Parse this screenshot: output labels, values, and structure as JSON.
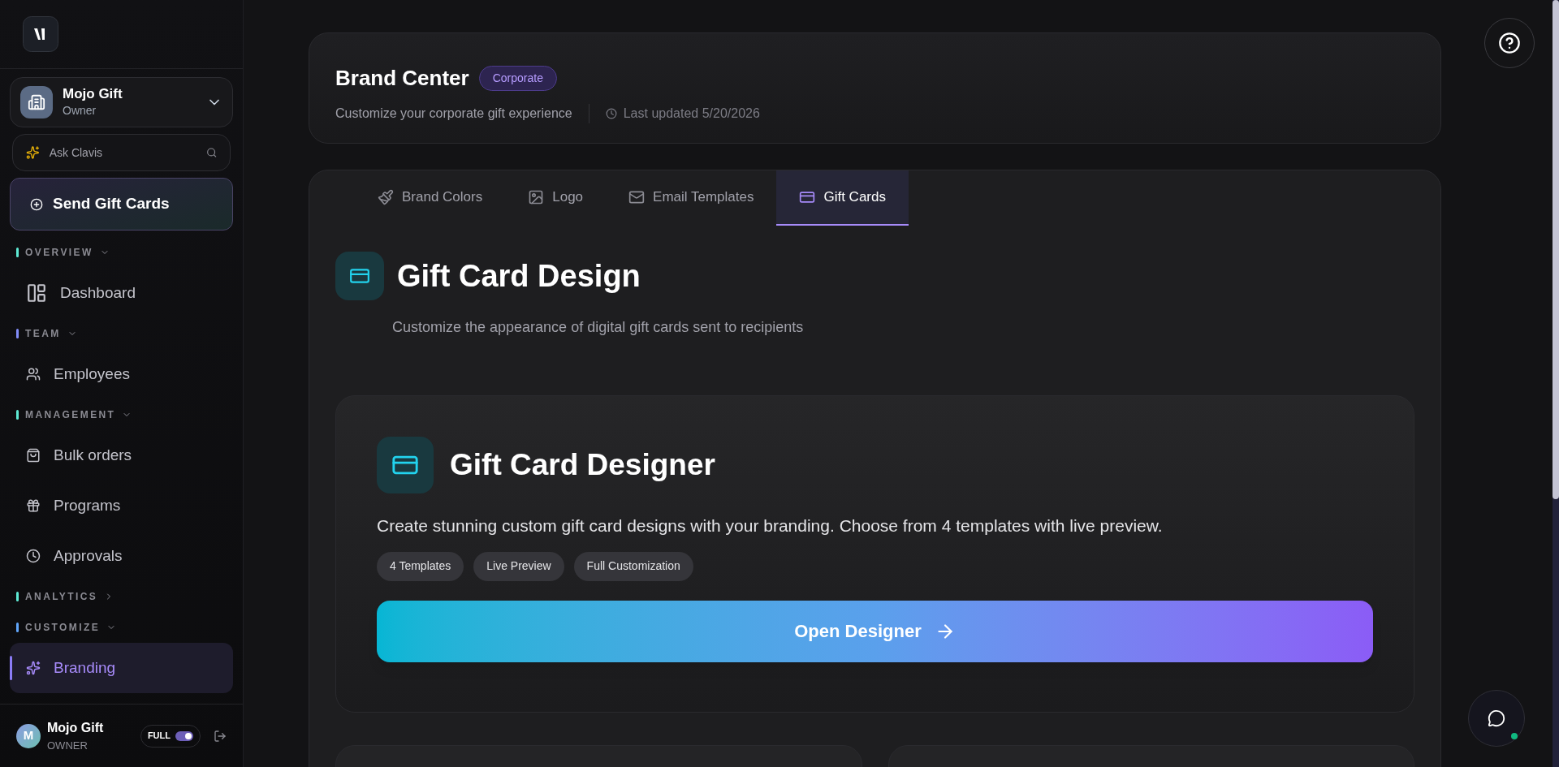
{
  "sidebar": {
    "account": {
      "name": "Mojo Gift",
      "role": "Owner"
    },
    "search": {
      "placeholder": "Ask Clavis"
    },
    "primary_button": "Send Gift Cards",
    "sections": [
      {
        "label": "OVERVIEW",
        "color": "#5eead4",
        "expanded": true,
        "items": [
          {
            "label": "Dashboard",
            "selected": false
          }
        ]
      },
      {
        "label": "TEAM",
        "color": "#818cf8",
        "expanded": true,
        "items": [
          {
            "label": "Employees",
            "selected": false
          }
        ]
      },
      {
        "label": "MANAGEMENT",
        "color": "#5eead4",
        "expanded": true,
        "items": [
          {
            "label": "Bulk orders",
            "selected": false
          },
          {
            "label": "Programs",
            "selected": false
          },
          {
            "label": "Approvals",
            "selected": false
          }
        ]
      },
      {
        "label": "ANALYTICS",
        "color": "#5eead4",
        "expanded": false
      },
      {
        "label": "CUSTOMIZE",
        "color": "#60a5fa",
        "expanded": true,
        "items": [
          {
            "label": "Branding",
            "selected": true
          }
        ]
      }
    ],
    "user": {
      "initial": "M",
      "name": "Mojo Gift",
      "role": "OWNER",
      "mode_label": "FULL",
      "mode_on": true
    }
  },
  "header": {
    "title": "Brand Center",
    "badge": "Corporate",
    "subtitle": "Customize your corporate gift experience",
    "updated": "Last updated 5/20/2026"
  },
  "tabs": [
    {
      "label": "Brand Colors",
      "selected": false
    },
    {
      "label": "Logo",
      "selected": false
    },
    {
      "label": "Email Templates",
      "selected": false
    },
    {
      "label": "Gift Cards",
      "selected": true
    }
  ],
  "section": {
    "title": "Gift Card Design",
    "description": "Customize the appearance of digital gift cards sent to recipients"
  },
  "designer_card": {
    "title": "Gift Card Designer",
    "description": "Create stunning custom gift card designs with your branding. Choose from 4 templates with live preview.",
    "tags": [
      "4 Templates",
      "Live Preview",
      "Full Customization"
    ],
    "button": "Open Designer"
  },
  "chat": {
    "online": true
  }
}
